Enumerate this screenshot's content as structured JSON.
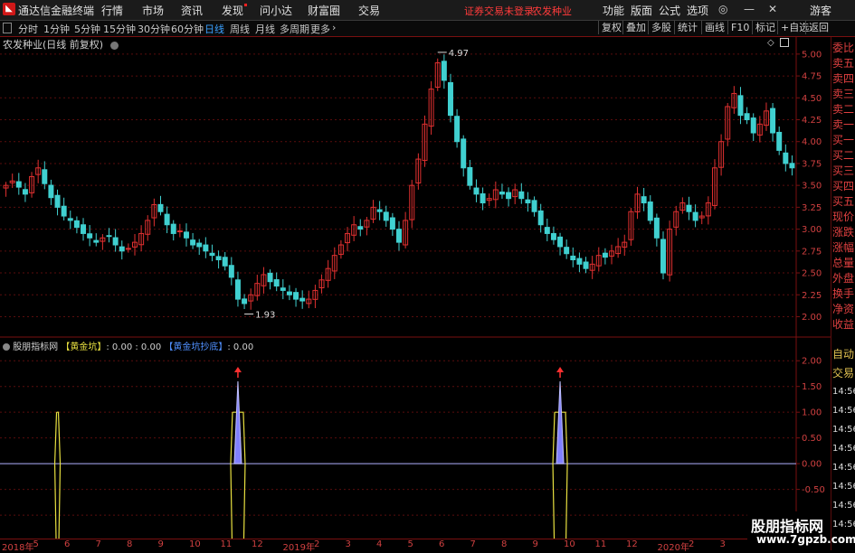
{
  "app": {
    "title": "通达信金融终端"
  },
  "menu": [
    "行情",
    "市场",
    "资讯",
    "发现",
    "问小达",
    "财富圈",
    "交易"
  ],
  "notice": {
    "login": "证券交易未登录",
    "stock": "农发种业"
  },
  "right_menu": [
    "功能",
    "版面",
    "公式",
    "选项"
  ],
  "guest": "游客",
  "periods": [
    "分时",
    "1分钟",
    "5分钟",
    "15分钟",
    "30分钟",
    "60分钟",
    "日线",
    "周线",
    "月线",
    "多周期",
    "更多"
  ],
  "active_period": "日线",
  "tools": [
    "复权",
    "叠加",
    "多股",
    "统计",
    "画线",
    "F10",
    "标记",
    "+自选",
    "返回"
  ],
  "chart_info": "农发种业(日线 前复权)",
  "indicator": {
    "name": "股朋指标网",
    "l1": "【黄金坑】",
    "v1": ": 0.00 : 0.00",
    "l2": "【黄金坑抄底】",
    "v2": ": 0.00"
  },
  "side_panel": [
    "委比",
    "卖五",
    "卖四",
    "卖三",
    "卖二",
    "卖一",
    "买一",
    "买二",
    "买三",
    "买四",
    "买五",
    "现价",
    "涨跌",
    "涨幅",
    "总量",
    "外盘",
    "换手",
    "净资",
    "收益"
  ],
  "side_panel2": [
    "自动",
    "交易",
    "14:56",
    "14:56",
    "14:56",
    "14:56",
    "14:56",
    "14:56",
    "14:56",
    "14:56"
  ],
  "watermark": {
    "cn": "股朋指标网",
    "url": "www.7gpzb.com"
  },
  "chart_data": [
    {
      "type": "candlestick",
      "ylim": [
        1.85,
        5.05
      ],
      "yticks": [
        "5.00",
        "4.75",
        "4.50",
        "4.25",
        "4.00",
        "3.75",
        "3.50",
        "3.25",
        "3.00",
        "2.75",
        "2.50",
        "2.25",
        "2.00"
      ],
      "annotations": [
        {
          "label": "4.97"
        },
        {
          "label": "1.93"
        }
      ],
      "x_labels": [
        "2018年",
        "5",
        "6",
        "7",
        "8",
        "9",
        "10",
        "11",
        "12",
        "2019年",
        "2",
        "3",
        "4",
        "5",
        "6",
        "7",
        "8",
        "9",
        "10",
        "11",
        "12",
        "2020年",
        "2",
        "3",
        "4"
      ],
      "close": [
        3.5,
        3.55,
        3.48,
        3.4,
        3.6,
        3.7,
        3.52,
        3.36,
        3.25,
        3.15,
        3.1,
        3.02,
        2.95,
        2.9,
        2.85,
        2.9,
        2.92,
        2.82,
        2.75,
        2.78,
        2.85,
        2.95,
        3.1,
        3.28,
        3.2,
        3.05,
        2.95,
        2.98,
        2.9,
        2.82,
        2.8,
        2.75,
        2.7,
        2.65,
        2.58,
        2.45,
        2.2,
        2.15,
        2.25,
        2.38,
        2.48,
        2.4,
        2.35,
        2.3,
        2.25,
        2.2,
        2.18,
        2.2,
        2.3,
        2.42,
        2.55,
        2.7,
        2.82,
        2.95,
        3.05,
        3.0,
        3.1,
        3.25,
        3.2,
        3.1,
        3.0,
        2.85,
        3.1,
        3.5,
        3.8,
        4.2,
        4.6,
        4.9,
        4.7,
        4.3,
        4.0,
        3.7,
        3.5,
        3.4,
        3.3,
        3.35,
        3.45,
        3.4,
        3.35,
        3.45,
        3.35,
        3.3,
        3.2,
        3.05,
        2.95,
        2.88,
        2.8,
        2.72,
        2.65,
        2.6,
        2.55,
        2.6,
        2.7,
        2.68,
        2.75,
        2.8,
        2.85,
        3.2,
        3.4,
        3.3,
        3.1,
        2.9,
        2.5,
        3.0,
        3.2,
        3.3,
        3.2,
        3.1,
        3.15,
        3.3,
        3.7,
        4.0,
        4.4,
        4.55,
        4.3,
        4.25,
        4.1,
        4.2,
        4.35,
        4.1,
        3.9,
        3.75,
        3.7
      ]
    },
    {
      "type": "indicator",
      "ylim": [
        -1.35,
        2.25
      ],
      "yticks": [
        "2.00",
        "1.50",
        "1.00",
        "0.50",
        "0.00",
        "-0.50",
        "-1.00"
      ],
      "signals": [
        {
          "x_index": 36,
          "value": 1.6
        },
        {
          "x_index": 86,
          "value": 1.6
        }
      ],
      "boxes": [
        {
          "x_index": 8,
          "value": 1.0
        },
        {
          "x_index": 36,
          "value": 1.0
        },
        {
          "x_index": 86,
          "value": 1.0
        }
      ]
    }
  ]
}
